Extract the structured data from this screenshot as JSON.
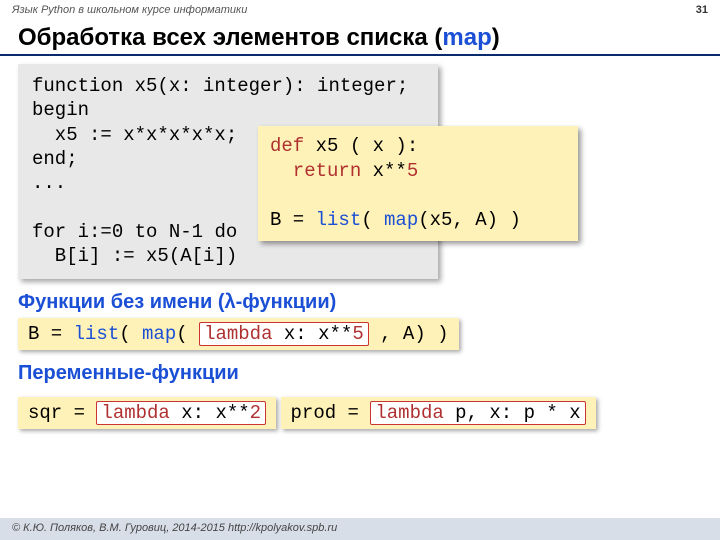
{
  "header": {
    "left": "Язык Python в школьном курсе информатики",
    "page": "31"
  },
  "title": {
    "pre": "Обработка всех элементов списка (",
    "map": "map",
    "post": ")"
  },
  "pascal": {
    "l1a": "function",
    "l1b": " x5(x: integer): integer;",
    "l2": "begin",
    "l3": "  x5 := x*x*x*x*x;",
    "l4": "end;",
    "l5": "...",
    "l6a": "for",
    "l6b": " i:=0 ",
    "l6c": "to",
    "l6d": " N-1 ",
    "l6e": "do",
    "l7": "  B[i] := x5(A[i])"
  },
  "python": {
    "l1a": "def",
    "l1b": " x5 ( x ):",
    "l2a": "  return",
    "l2b": " x**",
    "l2c": "5",
    "l3a": "B = ",
    "l3b": "list",
    "l3c": "( ",
    "l3d": "map",
    "l3e": "(x5, A) )"
  },
  "sec1": "Функции без имени (λ-функции)",
  "lam1": {
    "a": "B = ",
    "b": "list",
    "c": "( ",
    "d": "map",
    "e": "( ",
    "ins_a": "lambda",
    "ins_b": " x: x**",
    "ins_c": "5",
    "f": " , A) )"
  },
  "sec2": "Переменные-функции",
  "lam2": {
    "a": "sqr = ",
    "ins_a": "lambda",
    "ins_b": " x: x**",
    "ins_c": "2"
  },
  "lam3": {
    "a": "prod = ",
    "ins_a": "lambda",
    "ins_b": " p, x: p * x"
  },
  "footer": "© К.Ю. Поляков, В.М. Гуровиц, 2014-2015    http://kpolyakov.spb.ru"
}
